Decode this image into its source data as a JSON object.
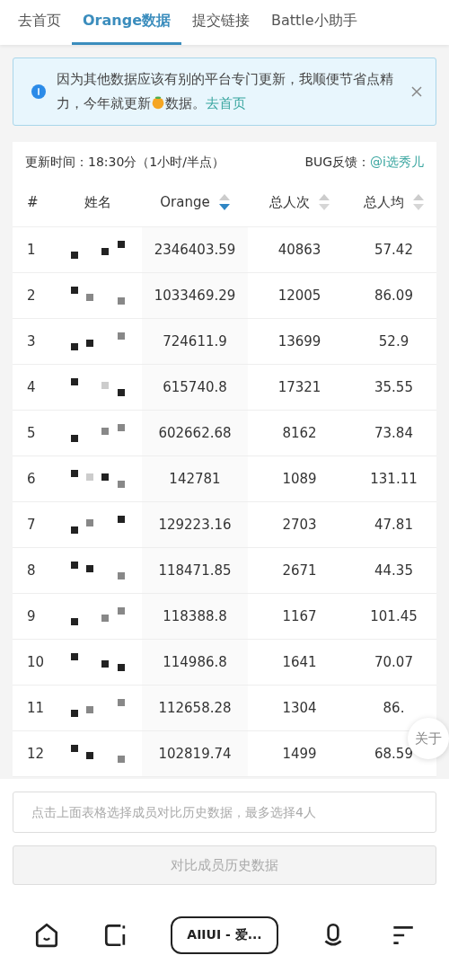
{
  "tabs": [
    {
      "label": "去首页",
      "selected": false
    },
    {
      "label": "Orange数据",
      "selected": true
    },
    {
      "label": "提交链接",
      "selected": false
    },
    {
      "label": "Battle小助手",
      "selected": false
    }
  ],
  "alert": {
    "text_before": "因为其他数据应该有别的平台专门更新，我顺便节省点精力，今年就更新",
    "text_after": "数据。",
    "link": "去首页"
  },
  "update_info": {
    "label": "更新时间：18:30分（1小时/半点）",
    "feedback_label": "BUG反馈：",
    "feedback_link": "@i选秀儿"
  },
  "table": {
    "columns": [
      {
        "label": "#"
      },
      {
        "label": "姓名"
      },
      {
        "label": "Orange",
        "sortable": true,
        "sorted_descending": true
      },
      {
        "label": "总人次",
        "sortable": true,
        "sorted_descending": false
      },
      {
        "label": "总人均",
        "sortable": true,
        "sorted_descending": false
      }
    ],
    "rows": [
      {
        "rank": "1",
        "orange": "2346403.59",
        "total_count": "40863",
        "average": "57.42"
      },
      {
        "rank": "2",
        "orange": "1033469.29",
        "total_count": "12005",
        "average": "86.09"
      },
      {
        "rank": "3",
        "orange": "724611.9",
        "total_count": "13699",
        "average": "52.9"
      },
      {
        "rank": "4",
        "orange": "615740.8",
        "total_count": "17321",
        "average": "35.55"
      },
      {
        "rank": "5",
        "orange": "602662.68",
        "total_count": "8162",
        "average": "73.84"
      },
      {
        "rank": "6",
        "orange": "142781",
        "total_count": "1089",
        "average": "131.11"
      },
      {
        "rank": "7",
        "orange": "129223.16",
        "total_count": "2703",
        "average": "47.81"
      },
      {
        "rank": "8",
        "orange": "118471.85",
        "total_count": "2671",
        "average": "44.35"
      },
      {
        "rank": "9",
        "orange": "118388.8",
        "total_count": "1167",
        "average": "101.45"
      },
      {
        "rank": "10",
        "orange": "114986.8",
        "total_count": "1641",
        "average": "70.07"
      },
      {
        "rank": "11",
        "orange": "112658.28",
        "total_count": "1304",
        "average": "86."
      },
      {
        "rank": "12",
        "orange": "102819.74",
        "total_count": "1499",
        "average": "68.59"
      }
    ]
  },
  "about_button": "关于",
  "compare_field": {
    "placeholder": "点击上面表格选择成员对比历史数据，最多选择4人"
  },
  "compare_button": {
    "label": "对比成员历史数据",
    "disabled": true
  },
  "nav": {
    "center_label": "AIIUI - 爱..."
  }
}
